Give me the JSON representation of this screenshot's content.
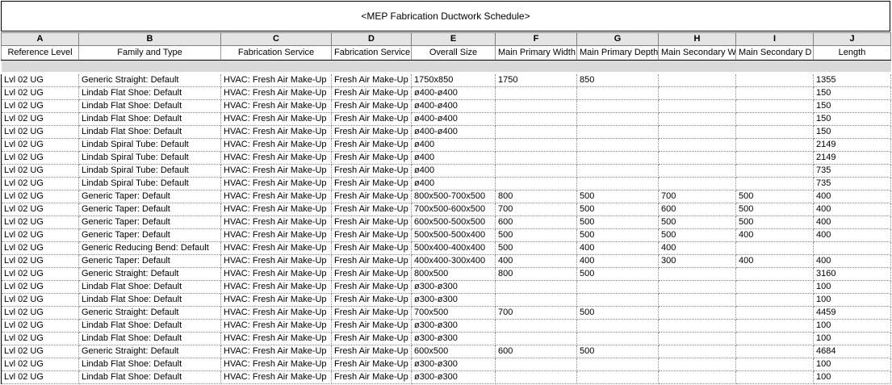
{
  "title": "<MEP Fabrication Ductwork Schedule>",
  "letters": [
    "A",
    "B",
    "C",
    "D",
    "E",
    "F",
    "G",
    "H",
    "I",
    "J"
  ],
  "headers": [
    "Reference Level",
    "Family and Type",
    "Fabrication Service",
    "Fabrication Service",
    "Overall Size",
    "Main Primary Width",
    "Main Primary Depth",
    "Main Secondary Wi",
    "Main Secondary D",
    "Length"
  ],
  "rows": [
    [
      "Lvl 02 UG",
      "Generic Straight: Default",
      "HVAC: Fresh Air Make-Up",
      "Fresh Air Make-Up",
      "1750x850",
      "1750",
      "850",
      "",
      "",
      "1355"
    ],
    [
      "Lvl 02 UG",
      "Lindab Flat Shoe: Default",
      "HVAC: Fresh Air Make-Up",
      "Fresh Air Make-Up",
      "ø400-ø400",
      "",
      "",
      "",
      "",
      "150"
    ],
    [
      "Lvl 02 UG",
      "Lindab Flat Shoe: Default",
      "HVAC: Fresh Air Make-Up",
      "Fresh Air Make-Up",
      "ø400-ø400",
      "",
      "",
      "",
      "",
      "150"
    ],
    [
      "Lvl 02 UG",
      "Lindab Flat Shoe: Default",
      "HVAC: Fresh Air Make-Up",
      "Fresh Air Make-Up",
      "ø400-ø400",
      "",
      "",
      "",
      "",
      "150"
    ],
    [
      "Lvl 02 UG",
      "Lindab Flat Shoe: Default",
      "HVAC: Fresh Air Make-Up",
      "Fresh Air Make-Up",
      "ø400-ø400",
      "",
      "",
      "",
      "",
      "150"
    ],
    [
      "Lvl 02 UG",
      "Lindab Spiral Tube: Default",
      "HVAC: Fresh Air Make-Up",
      "Fresh Air Make-Up",
      "ø400",
      "",
      "",
      "",
      "",
      "2149"
    ],
    [
      "Lvl 02 UG",
      "Lindab Spiral Tube: Default",
      "HVAC: Fresh Air Make-Up",
      "Fresh Air Make-Up",
      "ø400",
      "",
      "",
      "",
      "",
      "2149"
    ],
    [
      "Lvl 02 UG",
      "Lindab Spiral Tube: Default",
      "HVAC: Fresh Air Make-Up",
      "Fresh Air Make-Up",
      "ø400",
      "",
      "",
      "",
      "",
      "735"
    ],
    [
      "Lvl 02 UG",
      "Lindab Spiral Tube: Default",
      "HVAC: Fresh Air Make-Up",
      "Fresh Air Make-Up",
      "ø400",
      "",
      "",
      "",
      "",
      "735"
    ],
    [
      "Lvl 02 UG",
      "Generic Taper: Default",
      "HVAC: Fresh Air Make-Up",
      "Fresh Air Make-Up",
      "800x500-700x500",
      "800",
      "500",
      "700",
      "500",
      "400"
    ],
    [
      "Lvl 02 UG",
      "Generic Taper: Default",
      "HVAC: Fresh Air Make-Up",
      "Fresh Air Make-Up",
      "700x500-600x500",
      "700",
      "500",
      "600",
      "500",
      "400"
    ],
    [
      "Lvl 02 UG",
      "Generic Taper: Default",
      "HVAC: Fresh Air Make-Up",
      "Fresh Air Make-Up",
      "600x500-500x500",
      "600",
      "500",
      "500",
      "500",
      "400"
    ],
    [
      "Lvl 02 UG",
      "Generic Taper: Default",
      "HVAC: Fresh Air Make-Up",
      "Fresh Air Make-Up",
      "500x500-500x400",
      "500",
      "500",
      "500",
      "400",
      "400"
    ],
    [
      "Lvl 02 UG",
      "Generic Reducing Bend: Default",
      "HVAC: Fresh Air Make-Up",
      "Fresh Air Make-Up",
      "500x400-400x400",
      "500",
      "400",
      "400",
      "",
      ""
    ],
    [
      "Lvl 02 UG",
      "Generic Taper: Default",
      "HVAC: Fresh Air Make-Up",
      "Fresh Air Make-Up",
      "400x400-300x400",
      "400",
      "400",
      "300",
      "400",
      "400"
    ],
    [
      "Lvl 02 UG",
      "Generic Straight: Default",
      "HVAC: Fresh Air Make-Up",
      "Fresh Air Make-Up",
      "800x500",
      "800",
      "500",
      "",
      "",
      "3160"
    ],
    [
      "Lvl 02 UG",
      "Lindab Flat Shoe: Default",
      "HVAC: Fresh Air Make-Up",
      "Fresh Air Make-Up",
      "ø300-ø300",
      "",
      "",
      "",
      "",
      "100"
    ],
    [
      "Lvl 02 UG",
      "Lindab Flat Shoe: Default",
      "HVAC: Fresh Air Make-Up",
      "Fresh Air Make-Up",
      "ø300-ø300",
      "",
      "",
      "",
      "",
      "100"
    ],
    [
      "Lvl 02 UG",
      "Generic Straight: Default",
      "HVAC: Fresh Air Make-Up",
      "Fresh Air Make-Up",
      "700x500",
      "700",
      "500",
      "",
      "",
      "4459"
    ],
    [
      "Lvl 02 UG",
      "Lindab Flat Shoe: Default",
      "HVAC: Fresh Air Make-Up",
      "Fresh Air Make-Up",
      "ø300-ø300",
      "",
      "",
      "",
      "",
      "100"
    ],
    [
      "Lvl 02 UG",
      "Lindab Flat Shoe: Default",
      "HVAC: Fresh Air Make-Up",
      "Fresh Air Make-Up",
      "ø300-ø300",
      "",
      "",
      "",
      "",
      "100"
    ],
    [
      "Lvl 02 UG",
      "Generic Straight: Default",
      "HVAC: Fresh Air Make-Up",
      "Fresh Air Make-Up",
      "600x500",
      "600",
      "500",
      "",
      "",
      "4684"
    ],
    [
      "Lvl 02 UG",
      "Lindab Flat Shoe: Default",
      "HVAC: Fresh Air Make-Up",
      "Fresh Air Make-Up",
      "ø300-ø300",
      "",
      "",
      "",
      "",
      "100"
    ],
    [
      "Lvl 02 UG",
      "Lindab Flat Shoe: Default",
      "HVAC: Fresh Air Make-Up",
      "Fresh Air Make-Up",
      "ø300-ø300",
      "",
      "",
      "",
      "",
      "100"
    ]
  ]
}
